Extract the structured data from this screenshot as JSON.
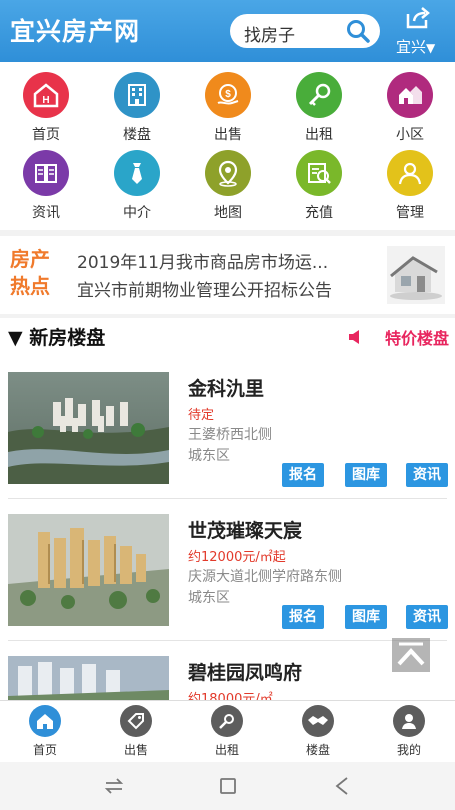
{
  "header": {
    "logo": "宜兴房产网",
    "search_placeholder": "找房子",
    "city": "宜兴",
    "city_caret": "▼"
  },
  "grid": [
    {
      "label": "首页",
      "icon": "home-icon",
      "color": "#e8334a"
    },
    {
      "label": "楼盘",
      "icon": "building-icon",
      "color": "#2f93c7"
    },
    {
      "label": "出售",
      "icon": "sale-icon",
      "color": "#f08a1c"
    },
    {
      "label": "出租",
      "icon": "key-icon",
      "color": "#49ad3a"
    },
    {
      "label": "小区",
      "icon": "community-icon",
      "color": "#b02a7e"
    },
    {
      "label": "资讯",
      "icon": "book-icon",
      "color": "#7b3aa8"
    },
    {
      "label": "中介",
      "icon": "tie-icon",
      "color": "#2aa5c9"
    },
    {
      "label": "地图",
      "icon": "map-pin-icon",
      "color": "#8ea12a"
    },
    {
      "label": "充值",
      "icon": "recharge-icon",
      "color": "#7ab82a"
    },
    {
      "label": "管理",
      "icon": "user-icon",
      "color": "#e3c21a"
    }
  ],
  "hot": {
    "title_line1": "房产",
    "title_line2": "热点",
    "news": [
      "2019年11月我市商品房市场运...",
      "宜兴市前期物业管理公开招标公告"
    ]
  },
  "section": {
    "title": "▼ 新房楼盘",
    "special": "特价楼盘"
  },
  "listings": [
    {
      "name": "金科氿里",
      "price": "待定",
      "address": "王婆桥西北侧",
      "district": "城东区"
    },
    {
      "name": "世茂璀璨天宸",
      "price": "约12000元/㎡起",
      "address": "庆源大道北侧学府路东侧",
      "district": "城东区"
    },
    {
      "name": "碧桂园凤鸣府",
      "price": "约18000元/㎡",
      "address": "",
      "district": ""
    }
  ],
  "card_buttons": {
    "signup": "报名",
    "gallery": "图库",
    "news": "资讯"
  },
  "bottom_nav": [
    {
      "label": "首页",
      "icon": "home-icon",
      "active": true
    },
    {
      "label": "出售",
      "icon": "sale-icon",
      "active": false
    },
    {
      "label": "出租",
      "icon": "key-icon",
      "active": false
    },
    {
      "label": "楼盘",
      "icon": "handshake-icon",
      "active": false
    },
    {
      "label": "我的",
      "icon": "user-icon",
      "active": false
    }
  ],
  "colors": {
    "brand": "#2f8fd8",
    "accent": "#e8265f",
    "price": "#e23a2b",
    "button": "#2c96e1"
  }
}
